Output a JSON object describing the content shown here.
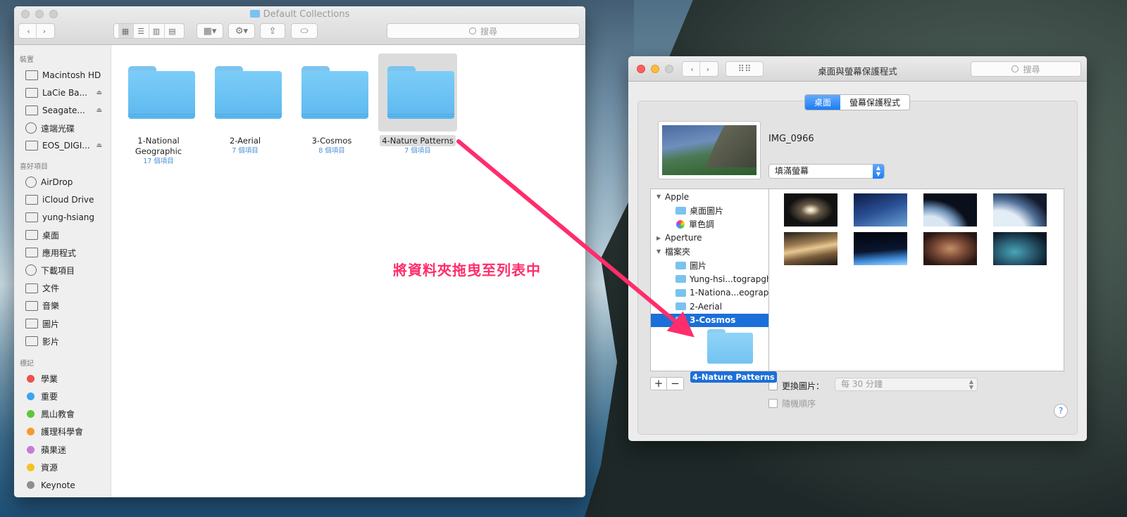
{
  "finder": {
    "title": "Default Collections",
    "search_placeholder": "搜尋",
    "sidebar": {
      "devices_header": "裝置",
      "devices": [
        {
          "label": "Macintosh HD",
          "icon": "internal-disk-icon",
          "eject": false
        },
        {
          "label": "LaCie Ba...",
          "icon": "external-disk-icon",
          "eject": true
        },
        {
          "label": "Seagate...",
          "icon": "external-disk-icon",
          "eject": true
        },
        {
          "label": "遠端光碟",
          "icon": "optical-disc-icon",
          "eject": false
        },
        {
          "label": "EOS_DIGI...",
          "icon": "sd-card-icon",
          "eject": true
        }
      ],
      "favorites_header": "喜好項目",
      "favorites": [
        {
          "label": "AirDrop",
          "icon": "airdrop-icon"
        },
        {
          "label": "iCloud Drive",
          "icon": "cloud-icon"
        },
        {
          "label": "yung-hsiang",
          "icon": "home-icon"
        },
        {
          "label": "桌面",
          "icon": "desktop-icon"
        },
        {
          "label": "應用程式",
          "icon": "applications-icon"
        },
        {
          "label": "下載項目",
          "icon": "downloads-icon"
        },
        {
          "label": "文件",
          "icon": "documents-icon"
        },
        {
          "label": "音樂",
          "icon": "music-icon"
        },
        {
          "label": "圖片",
          "icon": "camera-icon"
        },
        {
          "label": "影片",
          "icon": "film-icon"
        }
      ],
      "tags_header": "標記",
      "tags": [
        {
          "label": "學業",
          "color": "#f0504a"
        },
        {
          "label": "重要",
          "color": "#3aa4f2"
        },
        {
          "label": "鳳山教會",
          "color": "#5fc63a"
        },
        {
          "label": "護理科學會",
          "color": "#f79a2d"
        },
        {
          "label": "蘋果迷",
          "color": "#c77bd8"
        },
        {
          "label": "資源",
          "color": "#f5c320"
        },
        {
          "label": "Keynote",
          "color": "#8e8e8e"
        }
      ]
    },
    "folders": [
      {
        "name": "1-National Geographic",
        "count": "17 個項目"
      },
      {
        "name": "2-Aerial",
        "count": "7 個項目"
      },
      {
        "name": "3-Cosmos",
        "count": "8 個項目"
      },
      {
        "name": "4-Nature Patterns",
        "count": "7 個項目"
      }
    ]
  },
  "prefs": {
    "title": "桌面與螢幕保護程式",
    "search_placeholder": "搜尋",
    "tabs": [
      "桌面",
      "螢幕保護程式"
    ],
    "image_name": "IMG_0966",
    "fill_mode": "填滿螢幕",
    "source_list": [
      {
        "label": "Apple",
        "level": 0,
        "disclosure": "open"
      },
      {
        "label": "桌面圖片",
        "level": 1,
        "icon": "folder-icon"
      },
      {
        "label": "單色調",
        "level": 1,
        "icon": "color-wheel-icon"
      },
      {
        "label": "Aperture",
        "level": 0,
        "disclosure": "closed"
      },
      {
        "label": "檔案夾",
        "level": 0,
        "disclosure": "open"
      },
      {
        "label": "圖片",
        "level": 1,
        "icon": "folder-icon"
      },
      {
        "label": "Yung-hsi...tograpghy",
        "level": 1,
        "icon": "folder-icon"
      },
      {
        "label": "1-Nationa...eographic",
        "level": 1,
        "icon": "folder-icon"
      },
      {
        "label": "2-Aerial",
        "level": 1,
        "icon": "folder-icon"
      },
      {
        "label": "3-Cosmos",
        "level": 1,
        "icon": "folder-icon",
        "selected": true
      }
    ],
    "thumbnails": [
      "sombrero-galaxy",
      "milky-way",
      "earth-horizon",
      "earth-clouds",
      "saturn",
      "earth-night",
      "nebula",
      "eagle-nebula"
    ],
    "change_picture_label": "更換圖片：",
    "interval": "每 30 分鐘",
    "random_order_label": "隨機順序",
    "add_label": "+",
    "remove_label": "−",
    "help_label": "?"
  },
  "drag": {
    "ghost_label": "4-Nature Patterns",
    "annotation": "將資料夾拖曳至列表中",
    "annotation_color": "#ff2d6b"
  }
}
